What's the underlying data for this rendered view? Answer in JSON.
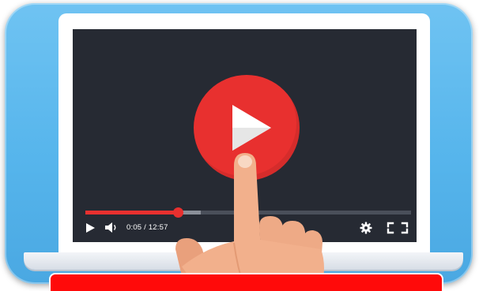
{
  "player": {
    "current_time": "0:05",
    "separator": "/",
    "duration": "12:57",
    "progress_fraction": 0.285,
    "buffered_fraction": 0.355
  },
  "icons": {
    "play_center": "play-icon",
    "play_small": "play-icon",
    "volume": "volume-icon",
    "settings": "gear-icon",
    "fullscreen": "fullscreen-icon",
    "hand": "pointing-hand-icon"
  },
  "colors": {
    "card_blue": "#56b5ec",
    "screen_dark": "#262a33",
    "accent_red": "#e8302f",
    "banner_red": "#ff0a0a",
    "skin": "#f2b08c"
  },
  "banner": {
    "text": ""
  }
}
